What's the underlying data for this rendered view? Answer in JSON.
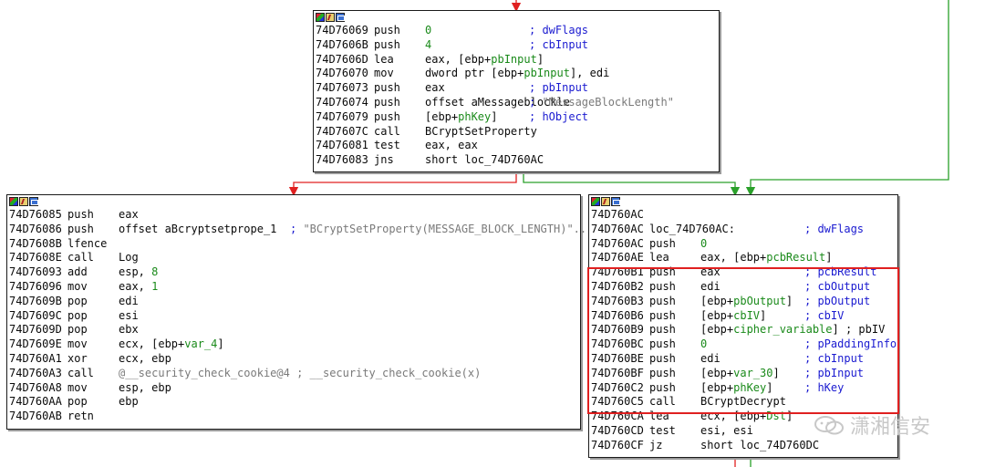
{
  "watermark": "潇湘信安",
  "top_block": {
    "lines": [
      {
        "addr": "74D76069",
        "mn": "push",
        "op": [
          {
            "t": "0",
            "c": "num"
          }
        ],
        "cm": "; dwFlags"
      },
      {
        "addr": "74D7606B",
        "mn": "push",
        "op": [
          {
            "t": "4",
            "c": "num"
          }
        ],
        "cm": "; cbInput"
      },
      {
        "addr": "74D7606D",
        "mn": "lea",
        "op": [
          {
            "t": "eax, [ebp+",
            "c": ""
          },
          {
            "t": "pbInput",
            "c": "sym"
          },
          {
            "t": "]",
            "c": ""
          }
        ],
        "cm": ""
      },
      {
        "addr": "74D76070",
        "mn": "mov",
        "op": [
          {
            "t": "dword ptr [ebp+",
            "c": ""
          },
          {
            "t": "pbInput",
            "c": "sym"
          },
          {
            "t": "], edi",
            "c": ""
          }
        ],
        "cm": ""
      },
      {
        "addr": "74D76073",
        "mn": "push",
        "op": [
          {
            "t": "eax",
            "c": ""
          }
        ],
        "cm": "; pbInput"
      },
      {
        "addr": "74D76074",
        "mn": "push",
        "op": [
          {
            "t": "offset aMessageblockle",
            "c": ""
          }
        ],
        "cm": "; ",
        "str": "\"MessageBlockLength\""
      },
      {
        "addr": "74D76079",
        "mn": "push",
        "op": [
          {
            "t": "[ebp+",
            "c": ""
          },
          {
            "t": "phKey",
            "c": "sym"
          },
          {
            "t": "]",
            "c": ""
          }
        ],
        "cm": "; hObject"
      },
      {
        "addr": "74D7607C",
        "mn": "call",
        "op": [
          {
            "t": "BCryptSetProperty",
            "c": ""
          }
        ],
        "cm": ""
      },
      {
        "addr": "74D76081",
        "mn": "test",
        "op": [
          {
            "t": "eax, eax",
            "c": ""
          }
        ],
        "cm": ""
      },
      {
        "addr": "74D76083",
        "mn": "jns",
        "op": [
          {
            "t": "short loc_74D760AC",
            "c": ""
          }
        ],
        "cm": ""
      }
    ]
  },
  "left_block": {
    "lines": [
      {
        "addr": "74D76085",
        "mn": "push",
        "op": [
          {
            "t": "eax",
            "c": ""
          }
        ],
        "cm": ""
      },
      {
        "addr": "74D76086",
        "mn": "push",
        "op": [
          {
            "t": "offset aBcryptsetprope_1",
            "c": ""
          }
        ],
        "cm": "; ",
        "str": "\"BCryptSetProperty(MESSAGE_BLOCK_LENGTH)\"..."
      },
      {
        "addr": "74D7608B",
        "mn": "lfence",
        "op": [],
        "cm": ""
      },
      {
        "addr": "74D7608E",
        "mn": "call",
        "op": [
          {
            "t": "Log",
            "c": ""
          }
        ],
        "cm": ""
      },
      {
        "addr": "74D76093",
        "mn": "add",
        "op": [
          {
            "t": "esp, ",
            "c": ""
          },
          {
            "t": "8",
            "c": "num"
          }
        ],
        "cm": ""
      },
      {
        "addr": "74D76096",
        "mn": "mov",
        "op": [
          {
            "t": "eax, ",
            "c": ""
          },
          {
            "t": "1",
            "c": "num"
          }
        ],
        "cm": ""
      },
      {
        "addr": "74D7609B",
        "mn": "pop",
        "op": [
          {
            "t": "edi",
            "c": ""
          }
        ],
        "cm": ""
      },
      {
        "addr": "74D7609C",
        "mn": "pop",
        "op": [
          {
            "t": "esi",
            "c": ""
          }
        ],
        "cm": ""
      },
      {
        "addr": "74D7609D",
        "mn": "pop",
        "op": [
          {
            "t": "ebx",
            "c": ""
          }
        ],
        "cm": ""
      },
      {
        "addr": "74D7609E",
        "mn": "mov",
        "op": [
          {
            "t": "ecx, [ebp+",
            "c": ""
          },
          {
            "t": "var_4",
            "c": "sym"
          },
          {
            "t": "]",
            "c": ""
          }
        ],
        "cm": ""
      },
      {
        "addr": "74D760A1",
        "mn": "xor",
        "op": [
          {
            "t": "ecx, ebp",
            "c": ""
          }
        ],
        "cm": ""
      },
      {
        "addr": "74D760A3",
        "mn": "call",
        "op": [
          {
            "t": "@__security_check_cookie@4",
            "c": "str"
          }
        ],
        "cm": "",
        "str2": "; __security_check_cookie(x)"
      },
      {
        "addr": "74D760A8",
        "mn": "mov",
        "op": [
          {
            "t": "esp, ebp",
            "c": ""
          }
        ],
        "cm": ""
      },
      {
        "addr": "74D760AA",
        "mn": "pop",
        "op": [
          {
            "t": "ebp",
            "c": ""
          }
        ],
        "cm": ""
      },
      {
        "addr": "74D760AB",
        "mn": "retn",
        "op": [],
        "cm": ""
      }
    ]
  },
  "right_block": {
    "lines": [
      {
        "addr": "74D760AC",
        "mn": "",
        "op": [],
        "cm": ""
      },
      {
        "addr": "74D760AC",
        "mn": "loc_74D760AC:",
        "op": [],
        "cm": "; dwFlags"
      },
      {
        "addr": "74D760AC",
        "mn": "push",
        "op": [
          {
            "t": "0",
            "c": "num"
          }
        ],
        "cm": ""
      },
      {
        "addr": "74D760AE",
        "mn": "lea",
        "op": [
          {
            "t": "eax, [ebp+",
            "c": ""
          },
          {
            "t": "pcbResult",
            "c": "sym"
          },
          {
            "t": "]",
            "c": ""
          }
        ],
        "cm": ""
      },
      {
        "addr": "74D760B1",
        "mn": "push",
        "op": [
          {
            "t": "eax",
            "c": ""
          }
        ],
        "cm": "; pcbResult"
      },
      {
        "addr": "74D760B2",
        "mn": "push",
        "op": [
          {
            "t": "edi",
            "c": ""
          }
        ],
        "cm": "; cbOutput"
      },
      {
        "addr": "74D760B3",
        "mn": "push",
        "op": [
          {
            "t": "[ebp+",
            "c": ""
          },
          {
            "t": "pbOutput",
            "c": "sym"
          },
          {
            "t": "]",
            "c": ""
          }
        ],
        "cm": "; pbOutput"
      },
      {
        "addr": "74D760B6",
        "mn": "push",
        "op": [
          {
            "t": "[ebp+",
            "c": ""
          },
          {
            "t": "cbIV",
            "c": "sym"
          },
          {
            "t": "]",
            "c": ""
          }
        ],
        "cm": "; cbIV"
      },
      {
        "addr": "74D760B9",
        "mn": "push",
        "op": [
          {
            "t": "[ebp+",
            "c": ""
          },
          {
            "t": "cipher_variable",
            "c": "sym"
          },
          {
            "t": "] ; pbIV",
            "c": ""
          }
        ],
        "cm": ""
      },
      {
        "addr": "74D760BC",
        "mn": "push",
        "op": [
          {
            "t": "0",
            "c": "num"
          }
        ],
        "cm": "; pPaddingInfo"
      },
      {
        "addr": "74D760BE",
        "mn": "push",
        "op": [
          {
            "t": "edi",
            "c": ""
          }
        ],
        "cm": "; cbInput"
      },
      {
        "addr": "74D760BF",
        "mn": "push",
        "op": [
          {
            "t": "[ebp+",
            "c": ""
          },
          {
            "t": "var_30",
            "c": "sym"
          },
          {
            "t": "]",
            "c": ""
          }
        ],
        "cm": "; pbInput"
      },
      {
        "addr": "74D760C2",
        "mn": "push",
        "op": [
          {
            "t": "[ebp+",
            "c": ""
          },
          {
            "t": "phKey",
            "c": "sym"
          },
          {
            "t": "]",
            "c": ""
          }
        ],
        "cm": "; hKey"
      },
      {
        "addr": "74D760C5",
        "mn": "call",
        "op": [
          {
            "t": "BCryptDecrypt",
            "c": ""
          }
        ],
        "cm": ""
      },
      {
        "addr": "74D760CA",
        "mn": "lea",
        "op": [
          {
            "t": "ecx, [ebp+",
            "c": ""
          },
          {
            "t": "Dst",
            "c": "sym"
          },
          {
            "t": "]",
            "c": ""
          }
        ],
        "cm": ""
      },
      {
        "addr": "74D760CD",
        "mn": "test",
        "op": [
          {
            "t": "esi, esi",
            "c": ""
          }
        ],
        "cm": ""
      },
      {
        "addr": "74D760CF",
        "mn": "jz",
        "op": [
          {
            "t": "short loc_74D760DC",
            "c": ""
          }
        ],
        "cm": ""
      }
    ]
  }
}
